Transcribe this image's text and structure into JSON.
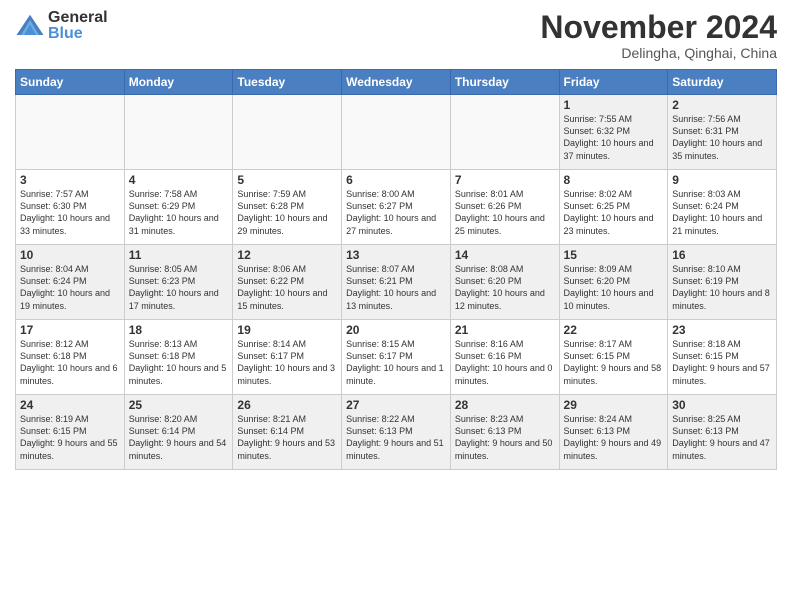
{
  "logo": {
    "general": "General",
    "blue": "Blue"
  },
  "title": "November 2024",
  "location": "Delingha, Qinghai, China",
  "days_of_week": [
    "Sunday",
    "Monday",
    "Tuesday",
    "Wednesday",
    "Thursday",
    "Friday",
    "Saturday"
  ],
  "weeks": [
    [
      {
        "day": "",
        "info": ""
      },
      {
        "day": "",
        "info": ""
      },
      {
        "day": "",
        "info": ""
      },
      {
        "day": "",
        "info": ""
      },
      {
        "day": "",
        "info": ""
      },
      {
        "day": "1",
        "info": "Sunrise: 7:55 AM\nSunset: 6:32 PM\nDaylight: 10 hours and 37 minutes."
      },
      {
        "day": "2",
        "info": "Sunrise: 7:56 AM\nSunset: 6:31 PM\nDaylight: 10 hours and 35 minutes."
      }
    ],
    [
      {
        "day": "3",
        "info": "Sunrise: 7:57 AM\nSunset: 6:30 PM\nDaylight: 10 hours and 33 minutes."
      },
      {
        "day": "4",
        "info": "Sunrise: 7:58 AM\nSunset: 6:29 PM\nDaylight: 10 hours and 31 minutes."
      },
      {
        "day": "5",
        "info": "Sunrise: 7:59 AM\nSunset: 6:28 PM\nDaylight: 10 hours and 29 minutes."
      },
      {
        "day": "6",
        "info": "Sunrise: 8:00 AM\nSunset: 6:27 PM\nDaylight: 10 hours and 27 minutes."
      },
      {
        "day": "7",
        "info": "Sunrise: 8:01 AM\nSunset: 6:26 PM\nDaylight: 10 hours and 25 minutes."
      },
      {
        "day": "8",
        "info": "Sunrise: 8:02 AM\nSunset: 6:25 PM\nDaylight: 10 hours and 23 minutes."
      },
      {
        "day": "9",
        "info": "Sunrise: 8:03 AM\nSunset: 6:24 PM\nDaylight: 10 hours and 21 minutes."
      }
    ],
    [
      {
        "day": "10",
        "info": "Sunrise: 8:04 AM\nSunset: 6:24 PM\nDaylight: 10 hours and 19 minutes."
      },
      {
        "day": "11",
        "info": "Sunrise: 8:05 AM\nSunset: 6:23 PM\nDaylight: 10 hours and 17 minutes."
      },
      {
        "day": "12",
        "info": "Sunrise: 8:06 AM\nSunset: 6:22 PM\nDaylight: 10 hours and 15 minutes."
      },
      {
        "day": "13",
        "info": "Sunrise: 8:07 AM\nSunset: 6:21 PM\nDaylight: 10 hours and 13 minutes."
      },
      {
        "day": "14",
        "info": "Sunrise: 8:08 AM\nSunset: 6:20 PM\nDaylight: 10 hours and 12 minutes."
      },
      {
        "day": "15",
        "info": "Sunrise: 8:09 AM\nSunset: 6:20 PM\nDaylight: 10 hours and 10 minutes."
      },
      {
        "day": "16",
        "info": "Sunrise: 8:10 AM\nSunset: 6:19 PM\nDaylight: 10 hours and 8 minutes."
      }
    ],
    [
      {
        "day": "17",
        "info": "Sunrise: 8:12 AM\nSunset: 6:18 PM\nDaylight: 10 hours and 6 minutes."
      },
      {
        "day": "18",
        "info": "Sunrise: 8:13 AM\nSunset: 6:18 PM\nDaylight: 10 hours and 5 minutes."
      },
      {
        "day": "19",
        "info": "Sunrise: 8:14 AM\nSunset: 6:17 PM\nDaylight: 10 hours and 3 minutes."
      },
      {
        "day": "20",
        "info": "Sunrise: 8:15 AM\nSunset: 6:17 PM\nDaylight: 10 hours and 1 minute."
      },
      {
        "day": "21",
        "info": "Sunrise: 8:16 AM\nSunset: 6:16 PM\nDaylight: 10 hours and 0 minutes."
      },
      {
        "day": "22",
        "info": "Sunrise: 8:17 AM\nSunset: 6:15 PM\nDaylight: 9 hours and 58 minutes."
      },
      {
        "day": "23",
        "info": "Sunrise: 8:18 AM\nSunset: 6:15 PM\nDaylight: 9 hours and 57 minutes."
      }
    ],
    [
      {
        "day": "24",
        "info": "Sunrise: 8:19 AM\nSunset: 6:15 PM\nDaylight: 9 hours and 55 minutes."
      },
      {
        "day": "25",
        "info": "Sunrise: 8:20 AM\nSunset: 6:14 PM\nDaylight: 9 hours and 54 minutes."
      },
      {
        "day": "26",
        "info": "Sunrise: 8:21 AM\nSunset: 6:14 PM\nDaylight: 9 hours and 53 minutes."
      },
      {
        "day": "27",
        "info": "Sunrise: 8:22 AM\nSunset: 6:13 PM\nDaylight: 9 hours and 51 minutes."
      },
      {
        "day": "28",
        "info": "Sunrise: 8:23 AM\nSunset: 6:13 PM\nDaylight: 9 hours and 50 minutes."
      },
      {
        "day": "29",
        "info": "Sunrise: 8:24 AM\nSunset: 6:13 PM\nDaylight: 9 hours and 49 minutes."
      },
      {
        "day": "30",
        "info": "Sunrise: 8:25 AM\nSunset: 6:13 PM\nDaylight: 9 hours and 47 minutes."
      }
    ]
  ]
}
